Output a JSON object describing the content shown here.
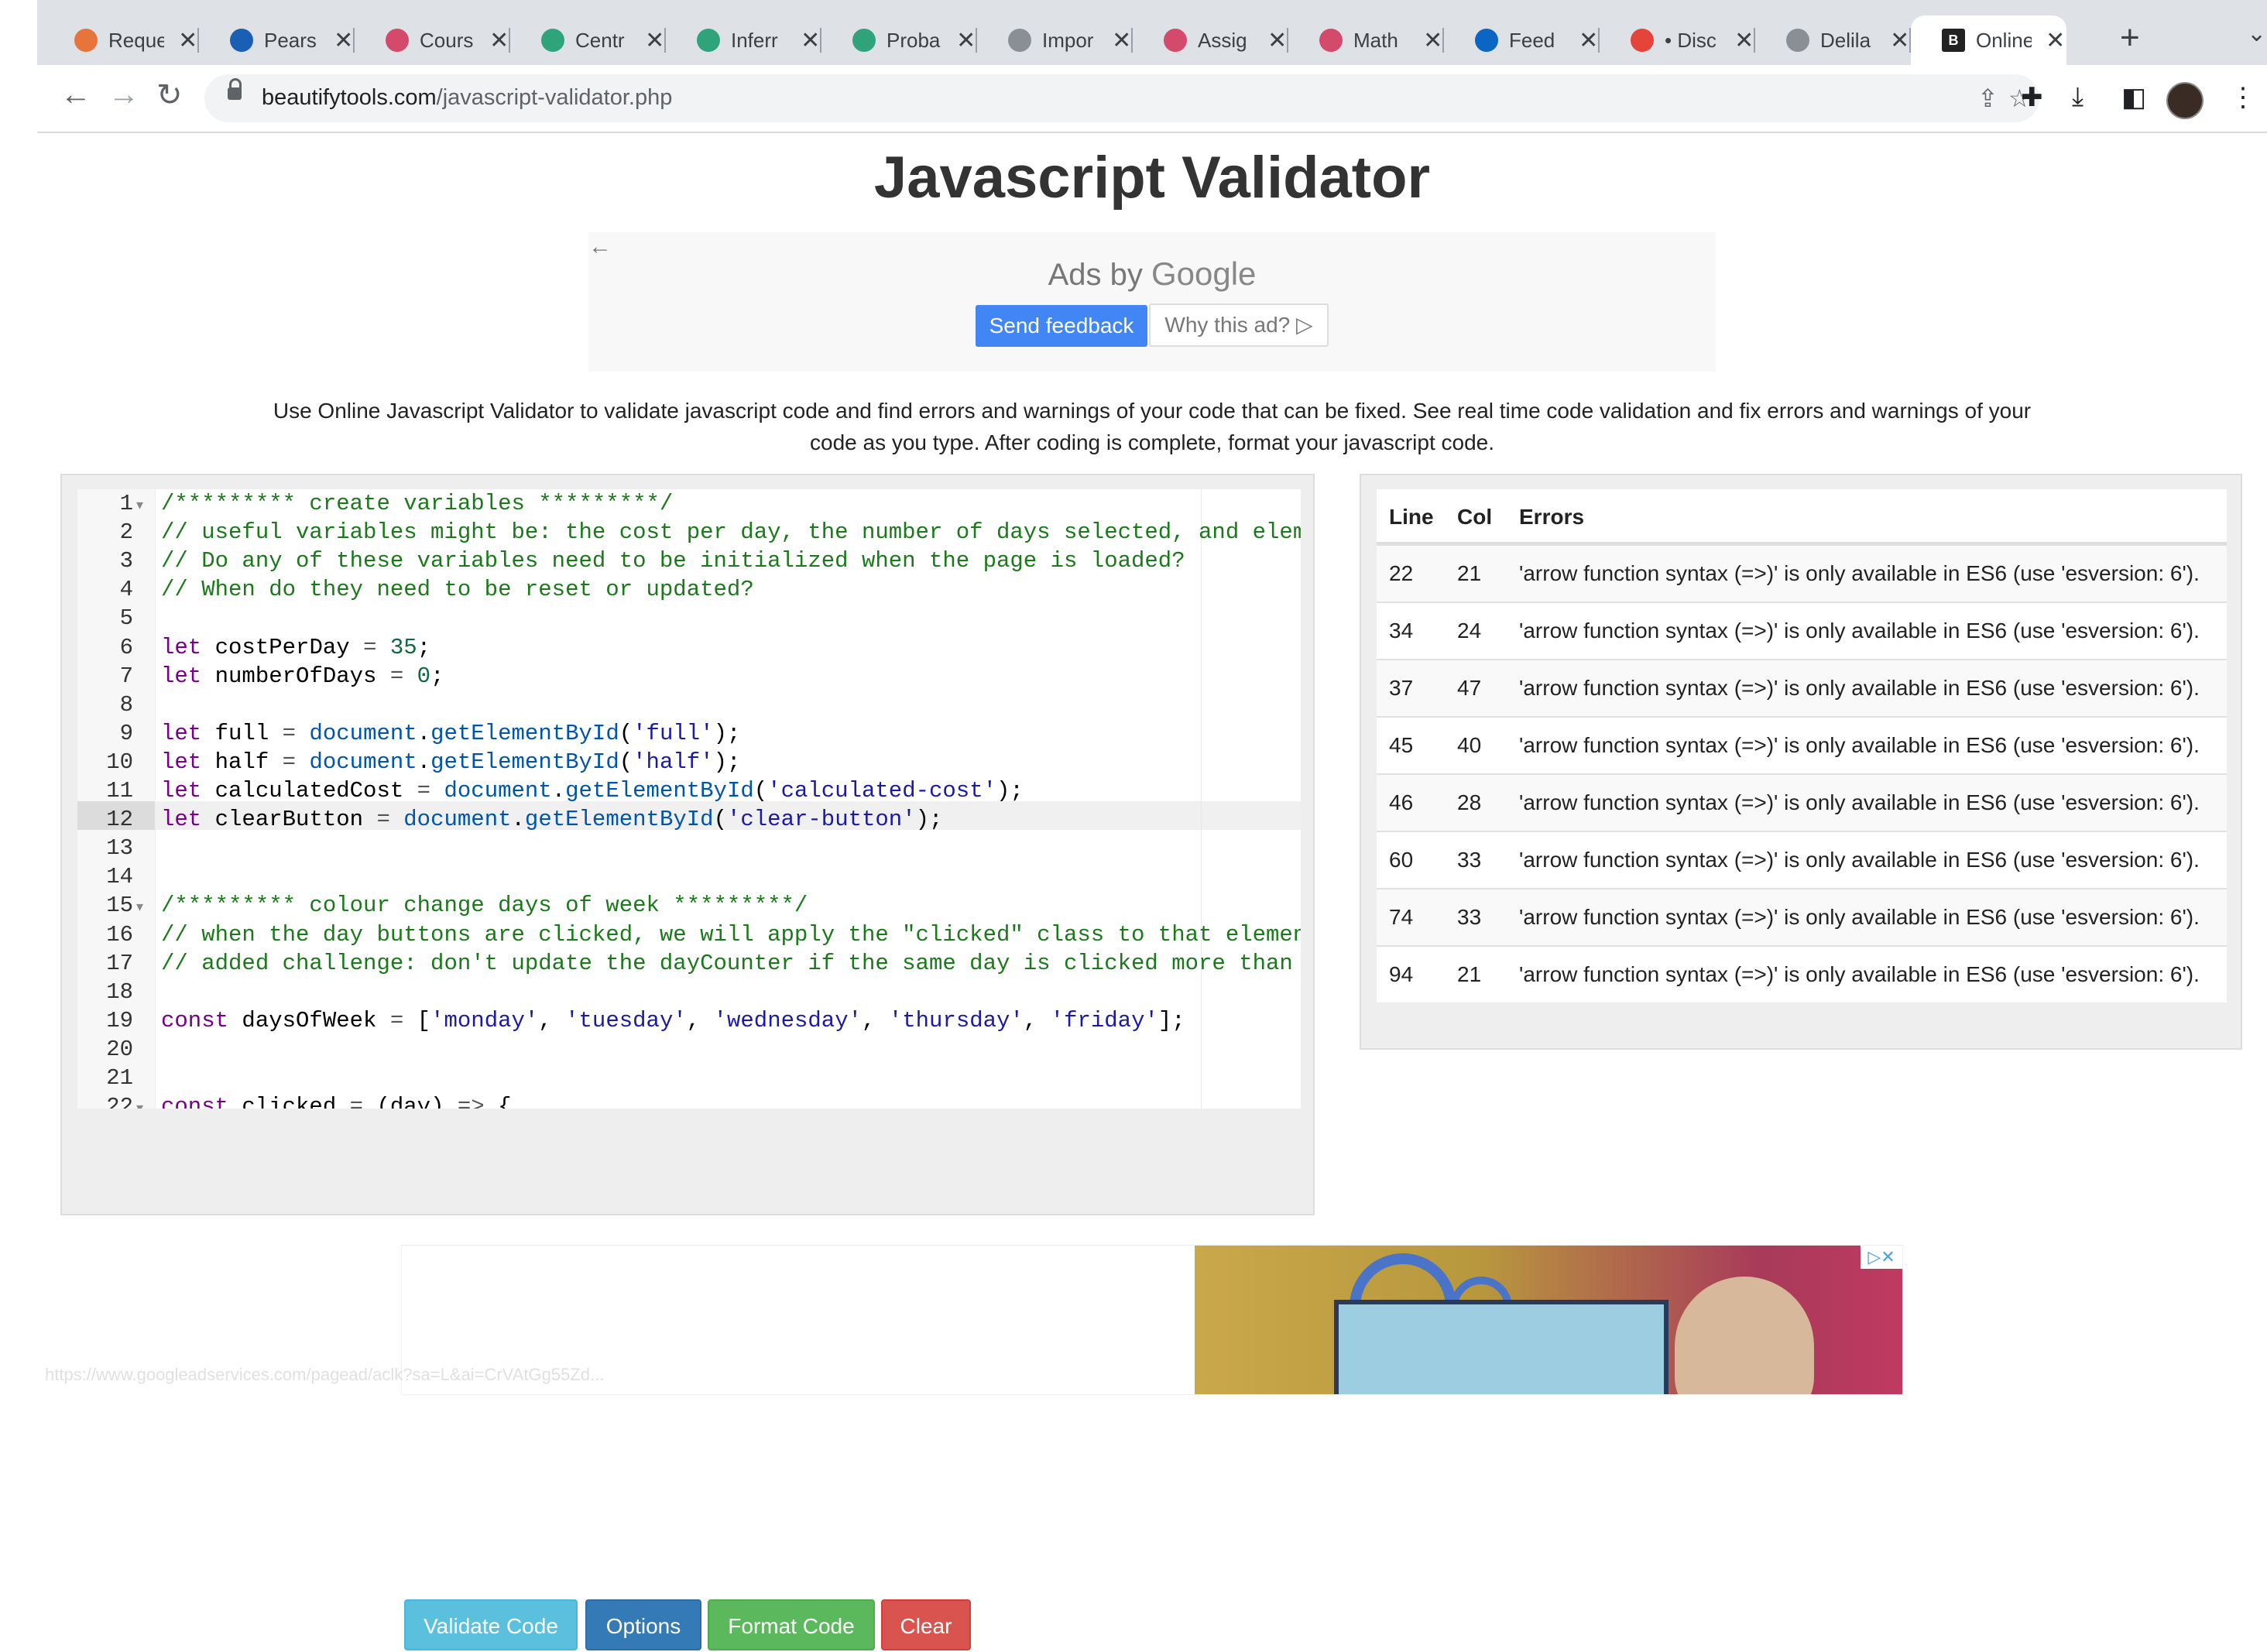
{
  "browser": {
    "tabs": [
      {
        "title": "Reque",
        "icon": "multicolor-icon",
        "color": "#e7743a"
      },
      {
        "title": "Pears",
        "icon": "pearson-icon",
        "color": "#1a5fb4"
      },
      {
        "title": "Cours",
        "icon": "course-icon",
        "color": "#d34a6a"
      },
      {
        "title": "Centr",
        "icon": "shield-icon",
        "color": "#2fa37a"
      },
      {
        "title": "Inferr",
        "icon": "shield-icon",
        "color": "#2fa37a"
      },
      {
        "title": "Proba",
        "icon": "shield-icon",
        "color": "#2fa37a"
      },
      {
        "title": "Impor",
        "icon": "globe-icon",
        "color": "#8a8f96"
      },
      {
        "title": "Assig",
        "icon": "course-icon",
        "color": "#d34a6a"
      },
      {
        "title": "Math",
        "icon": "course-icon",
        "color": "#d34a6a"
      },
      {
        "title": "Feed",
        "icon": "linkedin-icon",
        "color": "#0a66c2"
      },
      {
        "title": "• Disc",
        "icon": "chrome-icon",
        "color": "#e5443a"
      },
      {
        "title": "Delila",
        "icon": "globe-icon",
        "color": "#8a8f96"
      },
      {
        "title": "Online",
        "icon": "bt-icon",
        "color": "#222222",
        "active": true
      }
    ],
    "new_tab": "+",
    "url_domain": "beautifytools.com",
    "url_path": "/javascript-validator.php"
  },
  "page": {
    "title": "Javascript Validator",
    "ad_top": {
      "ads_by": "Ads by",
      "google": "Google",
      "send_feedback": "Send feedback",
      "why_this_ad": "Why this ad? ▷"
    },
    "description": "Use Online Javascript Validator to validate javascript code and find errors and warnings of your code that can be fixed. See real time code validation and fix errors and warnings of your code as you type. After coding is complete, format your javascript code.",
    "buttons": {
      "validate": "Validate Code",
      "options": "Options",
      "format": "Format Code",
      "clear": "Clear"
    },
    "errors_table": {
      "headers": [
        "Line",
        "Col",
        "Errors"
      ],
      "rows": [
        {
          "line": "22",
          "col": "21",
          "error": "'arrow function syntax (=>)' is only available in ES6 (use 'esversion: 6')."
        },
        {
          "line": "34",
          "col": "24",
          "error": "'arrow function syntax (=>)' is only available in ES6 (use 'esversion: 6')."
        },
        {
          "line": "37",
          "col": "47",
          "error": "'arrow function syntax (=>)' is only available in ES6 (use 'esversion: 6')."
        },
        {
          "line": "45",
          "col": "40",
          "error": "'arrow function syntax (=>)' is only available in ES6 (use 'esversion: 6')."
        },
        {
          "line": "46",
          "col": "28",
          "error": "'arrow function syntax (=>)' is only available in ES6 (use 'esversion: 6')."
        },
        {
          "line": "60",
          "col": "33",
          "error": "'arrow function syntax (=>)' is only available in ES6 (use 'esversion: 6')."
        },
        {
          "line": "74",
          "col": "33",
          "error": "'arrow function syntax (=>)' is only available in ES6 (use 'esversion: 6')."
        },
        {
          "line": "94",
          "col": "21",
          "error": "'arrow function syntax (=>)' is only available in ES6 (use 'esversion: 6')."
        }
      ]
    },
    "status_url": "https://www.googleadservices.com/pagead/aclk?sa=L&ai=CrVAtGg55Zd..."
  },
  "editor": {
    "active_line": "12",
    "lines": [
      {
        "n": "1",
        "fold": true,
        "text": "/********* create variables *********/"
      },
      {
        "n": "2",
        "text": "// useful variables might be: the cost per day, the number of days selected, and element"
      },
      {
        "n": "3",
        "text": "// Do any of these variables need to be initialized when the page is loaded?"
      },
      {
        "n": "4",
        "text": "// When do they need to be reset or updated?"
      },
      {
        "n": "5",
        "text": ""
      },
      {
        "n": "6",
        "text": "let costPerDay = 35;"
      },
      {
        "n": "7",
        "text": "let numberOfDays = 0;"
      },
      {
        "n": "8",
        "text": ""
      },
      {
        "n": "9",
        "text": "let full = document.getElementById('full');"
      },
      {
        "n": "10",
        "text": "let half = document.getElementById('half');"
      },
      {
        "n": "11",
        "text": "let calculatedCost = document.getElementById('calculated-cost');"
      },
      {
        "n": "12",
        "text": "let clearButton = document.getElementById('clear-button');"
      },
      {
        "n": "13",
        "text": ""
      },
      {
        "n": "14",
        "text": ""
      },
      {
        "n": "15",
        "fold": true,
        "text": "/********* colour change days of week *********/"
      },
      {
        "n": "16",
        "text": "// when the day buttons are clicked, we will apply the \"clicked\" class to that element,"
      },
      {
        "n": "17",
        "text": "// added challenge: don't update the dayCounter if the same day is clicked more than onc"
      },
      {
        "n": "18",
        "text": ""
      },
      {
        "n": "19",
        "text": "const daysOfWeek = ['monday', 'tuesday', 'wednesday', 'thursday', 'friday'];"
      },
      {
        "n": "20",
        "text": ""
      },
      {
        "n": "21",
        "text": ""
      },
      {
        "n": "22",
        "fold": true,
        "text": "const clicked = (day) => {"
      }
    ]
  }
}
